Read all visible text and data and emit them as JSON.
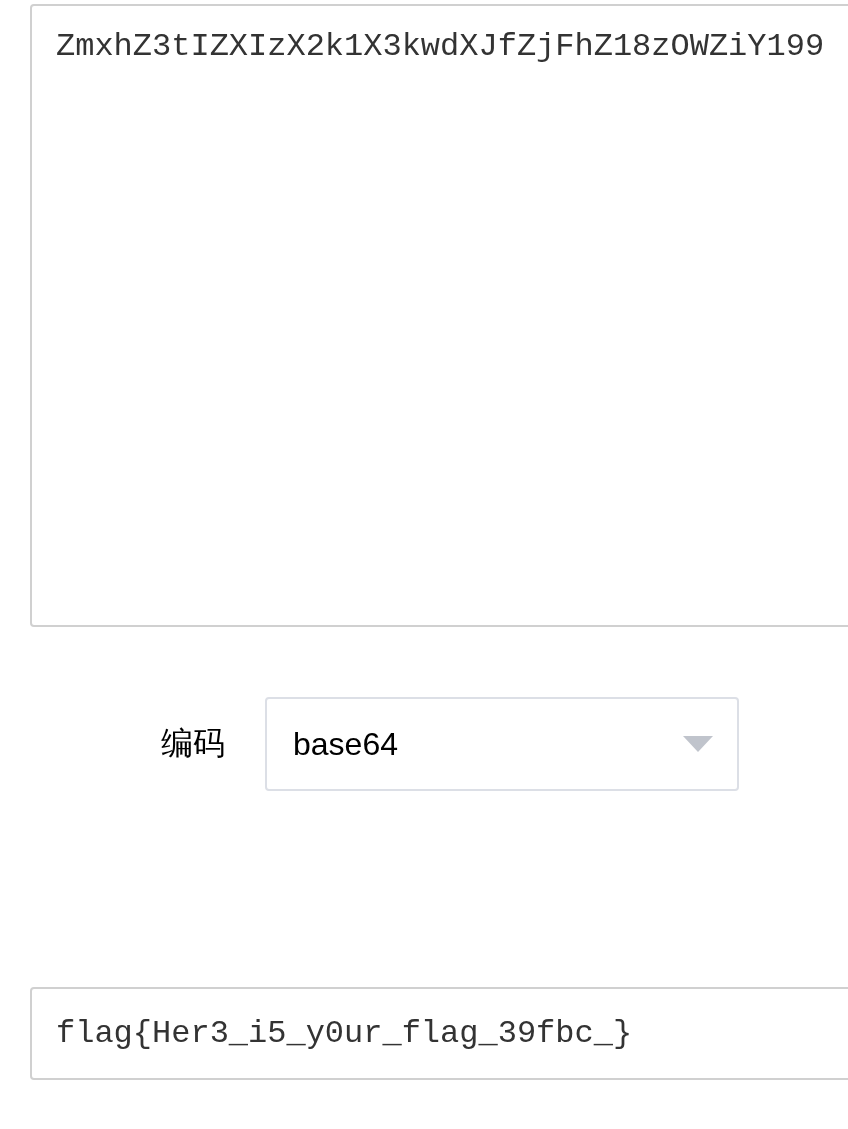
{
  "input": {
    "value": "ZmxhZ3tIZXIzX2k1X3kwdXJfZjFhZ18zOWZiY199"
  },
  "encoding": {
    "label": "编码",
    "value": "base64"
  },
  "output": {
    "value": "flag{Her3_i5_y0ur_flag_39fbc_}"
  }
}
